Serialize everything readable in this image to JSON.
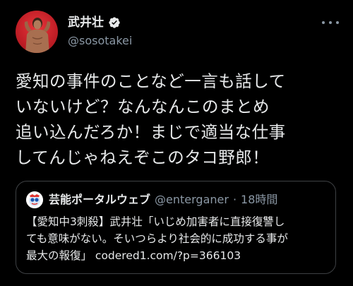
{
  "user": {
    "display_name": "武井壮",
    "handle": "@sosotakei",
    "verified": true
  },
  "tweet": {
    "text": "愛知の事件のことなど一言も話して\nいないけど？なんなんこのまとめ\n追い込んだろか！まじで適当な仕事\nしてんじゃねえぞこのタコ野郎！"
  },
  "quote": {
    "display_name": "芸能ポータルウェブ",
    "handle": "@enterganer",
    "separator": "·",
    "time": "18時間",
    "text": "【愛知中3刺殺】武井壮「いじめ加害者に直接復讐し\nても意味がない。そいつらより社会的に成功する事が\n最大の報復」 codered1.com/?p=366103"
  },
  "icons": {
    "verified": "verified-badge-icon",
    "more": "more-options-icon"
  },
  "colors": {
    "background": "#000000",
    "text": "#e7e9ea",
    "secondary_text": "#8b98a5",
    "border": "#3e4144",
    "avatar_red": "#c01e26"
  }
}
